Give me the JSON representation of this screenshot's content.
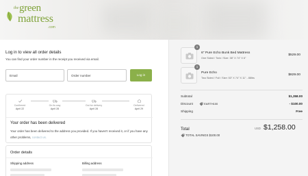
{
  "brand": {
    "logo_the": "the",
    "logo_green": "green",
    "logo_mattress": "mattress",
    "logo_dotcom": ".com"
  },
  "login": {
    "title": "Log in to view all order details",
    "subtitle": "You can find your order number in the receipt you received via email.",
    "email_placeholder": "Email",
    "order_placeholder": "Order number",
    "button_label": "Log in"
  },
  "timeline": {
    "steps": [
      {
        "label": "Confirmed",
        "date": "April 22",
        "icon": "check-icon"
      },
      {
        "label": "On its way",
        "date": "April 28",
        "icon": "truck-icon"
      },
      {
        "label": "Out for delivery",
        "date": "April 28",
        "icon": "truck-icon"
      },
      {
        "label": "Delivered",
        "date": "April 29",
        "icon": "home-icon"
      }
    ]
  },
  "status": {
    "title": "Your order has been delivered",
    "text": "Your order has been delivered to the address you provided. If you haven't received it, or if you have any other problems,",
    "link": "contact us."
  },
  "details": {
    "title": "Order details",
    "shipping_label": "Shipping address",
    "billing_label": "Billing address"
  },
  "summary": {
    "items": [
      {
        "qty": "1",
        "name": "6\" Pure Echo Bunk Bed Mattress",
        "variant": "One Sided / Twin / Size: 38\" X 74\" X 6\"",
        "price": "$529.00"
      },
      {
        "qty": "1",
        "name": "Pure Echo",
        "variant": "Two Sided / Full / Size: 53\" X 74\" X 11\" - 88lbs",
        "price": "$829.00"
      }
    ],
    "subtotal_label": "Subtotal",
    "subtotal_value": "$1,358.00",
    "discount_label": "Discount",
    "discount_code": "EARTH100",
    "discount_value": "- $100.00",
    "shipping_label": "Shipping",
    "shipping_value": "Free",
    "total_label": "Total",
    "currency": "USD",
    "total_value": "$1,258.00",
    "savings": "TOTAL SAVINGS $100.00"
  },
  "colors": {
    "accent": "#8bb04a",
    "brand": "#7fa33a",
    "link": "#9cb7c9",
    "sidebar_bg": "#f4f4f4"
  }
}
